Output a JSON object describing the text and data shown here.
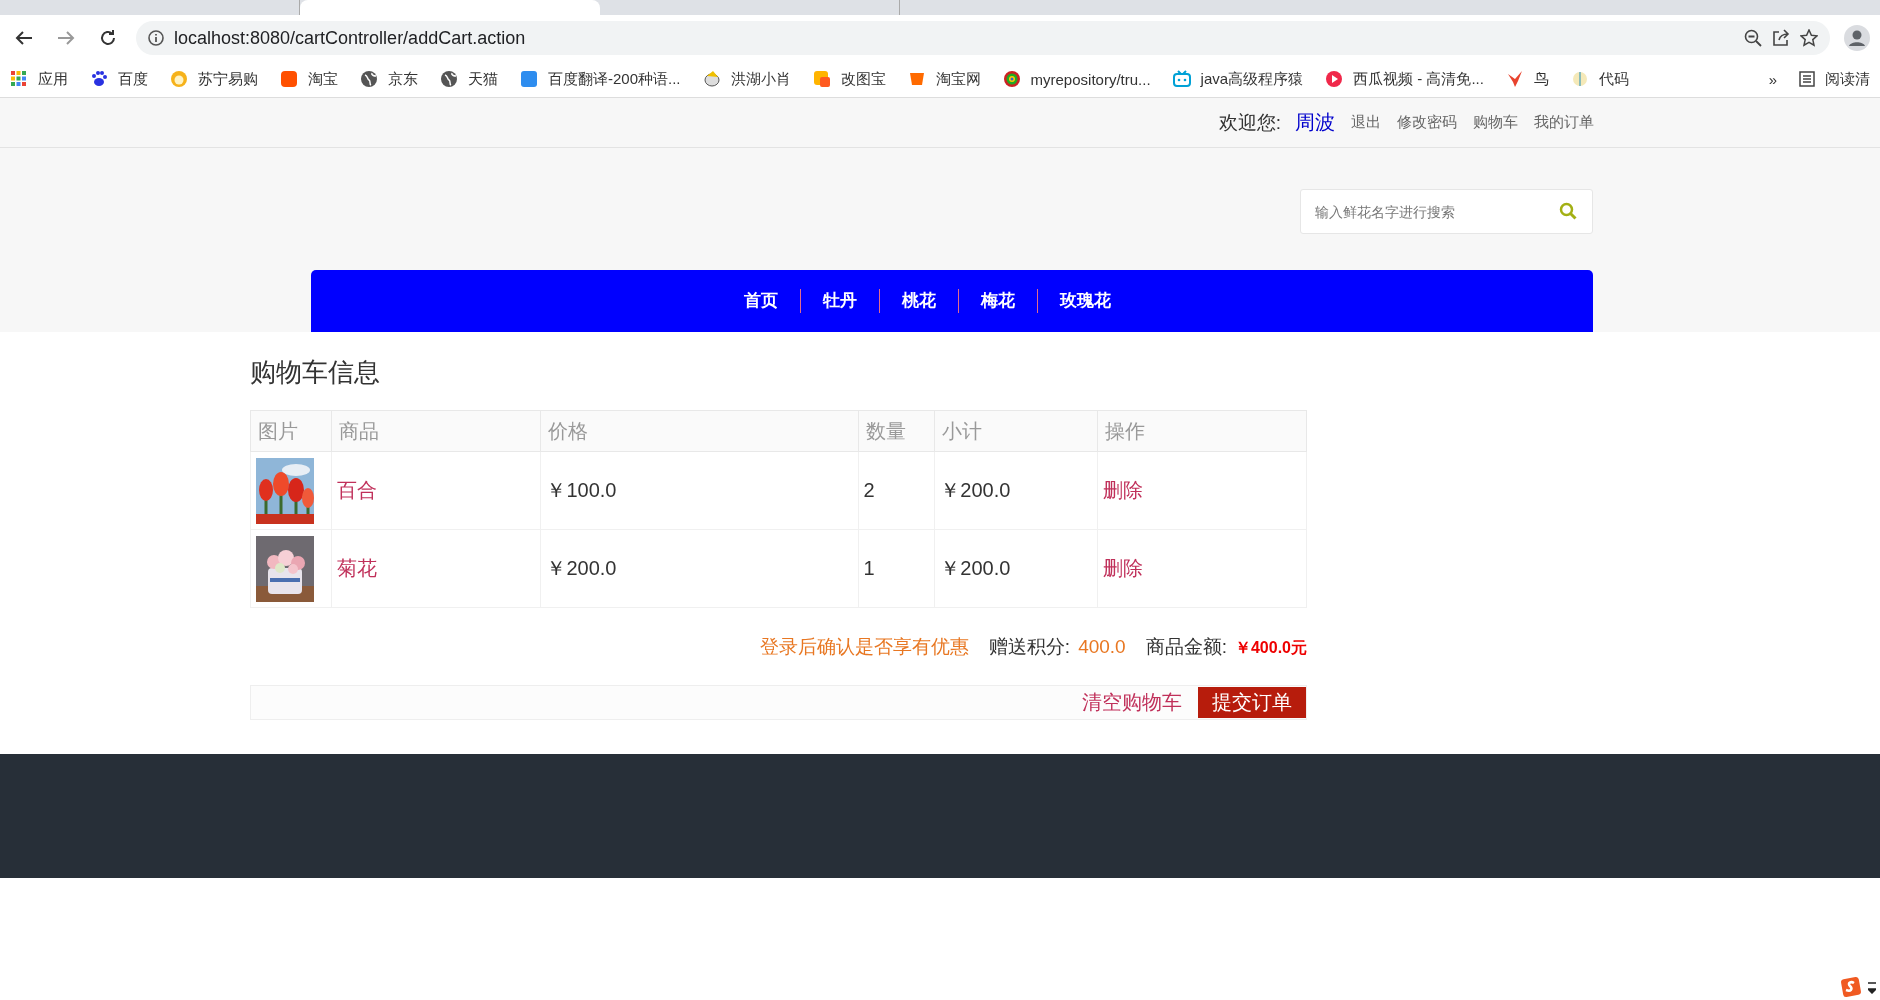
{
  "browser": {
    "tabs": [
      {
        "selected": false
      },
      {
        "selected": true
      },
      {
        "selected": false
      }
    ],
    "url": "localhost:8080/cartController/addCart.action",
    "bookmarks": [
      "应用",
      "百度",
      "苏宁易购",
      "淘宝",
      "京东",
      "天猫",
      "百度翻译-200种语...",
      "洪湖小肖",
      "改图宝",
      "淘宝网",
      "myrepository/tru...",
      "java高级程序猿",
      "西瓜视频 - 高清免...",
      "鸟",
      "代码"
    ],
    "more": "»",
    "reading_list": "阅读清"
  },
  "header": {
    "welcome": "欢迎您:",
    "user": "周波",
    "links": [
      "退出",
      "修改密码",
      "购物车",
      "我的订单"
    ],
    "search": {
      "placeholder": "输入鲜花名字进行搜索"
    }
  },
  "nav": [
    "首页",
    "牡丹",
    "桃花",
    "梅花",
    "玫瑰花"
  ],
  "cart": {
    "title": "购物车信息",
    "columns": [
      "图片",
      "商品",
      "价格",
      "数量",
      "小计",
      "操作"
    ],
    "rows": [
      {
        "product": "百合",
        "price": "￥100.0",
        "quantity": "2",
        "subtotal": "￥200.0",
        "action": "删除"
      },
      {
        "product": "菊花",
        "price": "￥200.0",
        "quantity": "1",
        "subtotal": "￥200.0",
        "action": "删除"
      }
    ],
    "notice": "登录后确认是否享有优惠",
    "points_label": "赠送积分:",
    "points": "400.0",
    "amount_label": "商品金额:",
    "amount": "￥400.0元",
    "clear_button": "清空购物车",
    "submit_button": "提交订单"
  }
}
